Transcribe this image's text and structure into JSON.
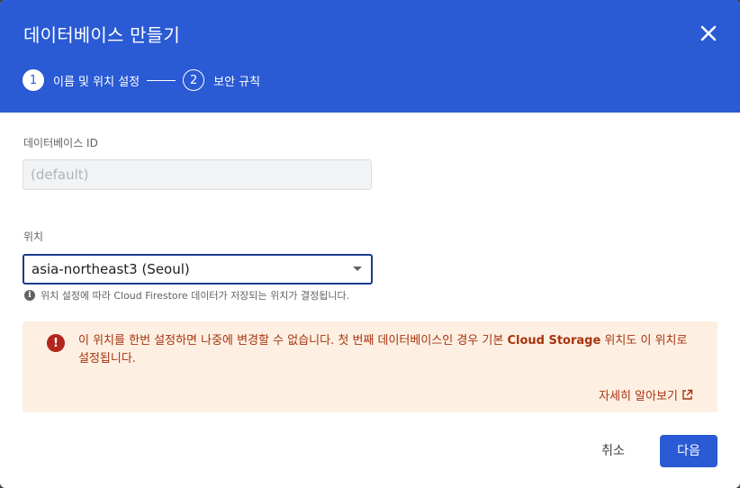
{
  "dialog": {
    "title": "데이터베이스 만들기",
    "steps": [
      {
        "number": "1",
        "label": "이름 및 위치 설정",
        "state": "active"
      },
      {
        "number": "2",
        "label": "보안 규칙",
        "state": "inactive"
      }
    ]
  },
  "form": {
    "db_id_label": "데이터베이스 ID",
    "db_id_placeholder": "(default)",
    "location_label": "위치",
    "location_value": "asia-northeast3 (Seoul)",
    "location_hint": "위치 설정에 따라 Cloud Firestore 데이터가 저장되는 위치가 결정됩니다."
  },
  "warning": {
    "text_before": "이 위치를 한번 설정하면 나중에 변경할 수 없습니다. 첫 번째 데이터베이스인 경우 기본 ",
    "text_bold": "Cloud Storage",
    "text_after": " 위치도 이 위치로 설정됩니다.",
    "learn_more": "자세히 알아보기"
  },
  "actions": {
    "cancel": "취소",
    "next": "다음"
  },
  "colors": {
    "header": "#2a5ad4",
    "warning_bg": "#fdf0e2",
    "warning_text": "#a8320e",
    "warning_icon": "#b3261e"
  },
  "icons": {
    "close": "close-icon",
    "info": "info-icon",
    "warning": "error-icon",
    "external": "open-in-new-icon",
    "dropdown": "caret-down-icon"
  }
}
